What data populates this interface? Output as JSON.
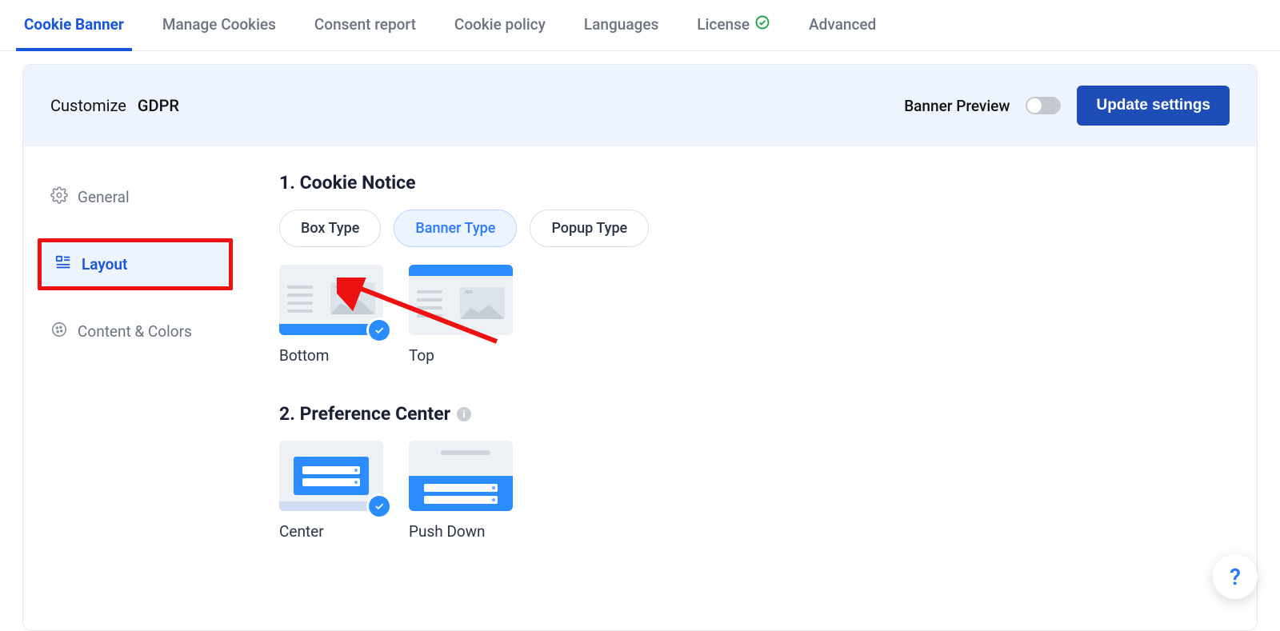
{
  "tabs": {
    "cookie_banner": "Cookie Banner",
    "manage_cookies": "Manage Cookies",
    "consent_report": "Consent report",
    "cookie_policy": "Cookie policy",
    "languages": "Languages",
    "license": "License",
    "advanced": "Advanced"
  },
  "header": {
    "customize_label": "Customize",
    "regulation": "GDPR",
    "banner_preview_label": "Banner Preview",
    "update_button": "Update settings"
  },
  "sidebar": {
    "general": "General",
    "layout": "Layout",
    "content_colors": "Content & Colors"
  },
  "sections": {
    "cookie_notice": {
      "title": "1. Cookie Notice",
      "types": {
        "box": "Box Type",
        "banner": "Banner Type",
        "popup": "Popup Type"
      },
      "options": {
        "bottom": "Bottom",
        "top": "Top"
      }
    },
    "preference_center": {
      "title": "2. Preference Center",
      "options": {
        "center": "Center",
        "push_down": "Push Down"
      }
    }
  },
  "help": "?"
}
